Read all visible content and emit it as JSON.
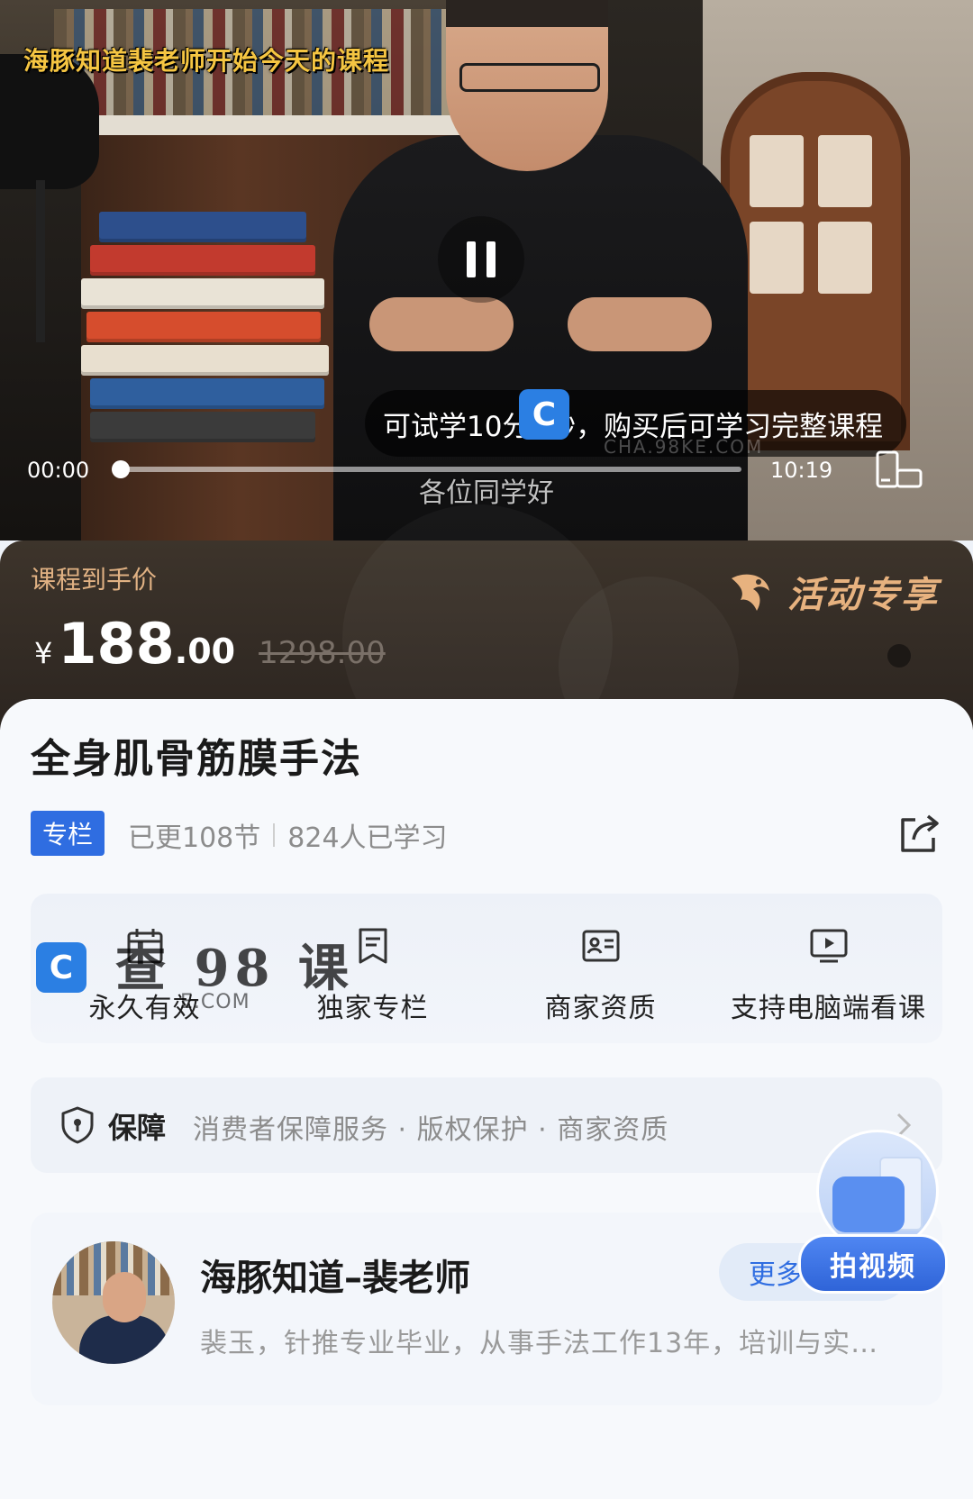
{
  "video": {
    "overlay_title": "海豚知道裴老师开始今天的课程",
    "trial_notice": "可试学10分0秒，购买后可学习完整课程",
    "current_time": "00:00",
    "duration": "10:19",
    "progress": 0,
    "subtitle": "各位同学好",
    "watermark_text": "CHA.98KE.COM"
  },
  "price_banner": {
    "label": "课程到手价",
    "currency": "¥",
    "price_integer": "188",
    "price_decimal": ".00",
    "original_price": "1298.00",
    "activity_label": "活动专享"
  },
  "course": {
    "title": "全身肌骨筋膜手法",
    "tag": "专栏",
    "updated": "已更108节",
    "learners": "824人已学习"
  },
  "features": [
    {
      "icon": "calendar-icon",
      "label": "永久有效"
    },
    {
      "icon": "bookmark-icon",
      "label": "独家专栏"
    },
    {
      "icon": "id-card-icon",
      "label": "商家资质"
    },
    {
      "icon": "monitor-play-icon",
      "label": "支持电脑端看课"
    }
  ],
  "watermark": {
    "badge": "C",
    "text": "查 98 课",
    "url": "E.COM"
  },
  "guarantee": {
    "title": "保障",
    "text": "消费者保障服务 · 版权保护 · 商家资质"
  },
  "teacher": {
    "name": "海豚知道–裴老师",
    "description": "裴玉，针推专业毕业，从事手法工作13年，培训与实…",
    "more_courses": "更多课程"
  },
  "float_button": {
    "label": "拍视频"
  },
  "colors": {
    "accent_blue": "#2f6de1",
    "price_gold": "#e0b183",
    "banner_bg": "#3d342b"
  }
}
